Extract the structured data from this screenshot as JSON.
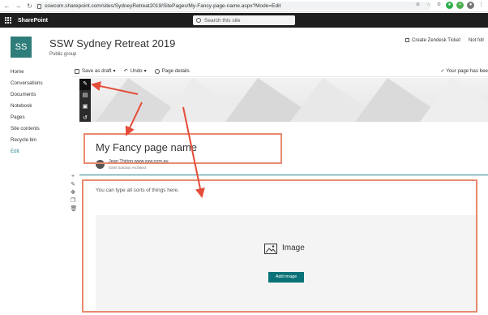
{
  "browser": {
    "url": "sswcom.sharepoint.com/sites/SydneyRetreat2019/SitePages/My-Fancy-page-name.aspx?Mode=Edit",
    "nav_back": "←",
    "nav_forward": "→",
    "nav_reload": "↻"
  },
  "suite": {
    "title": "SharePoint",
    "search_placeholder": "Search this site"
  },
  "site": {
    "logo": "SS",
    "title": "SSW Sydney Retreat 2019",
    "subtitle": "Public group",
    "action_ticket": "Create Zendesk Ticket",
    "action_follow": "Not foll"
  },
  "nav": {
    "items": [
      {
        "label": "Home"
      },
      {
        "label": "Conversations"
      },
      {
        "label": "Documents"
      },
      {
        "label": "Notebook"
      },
      {
        "label": "Pages"
      },
      {
        "label": "Site contents"
      },
      {
        "label": "Recycle bin"
      }
    ],
    "edit": "Edit"
  },
  "cmdbar": {
    "save_draft": "Save as draft",
    "undo": "Undo",
    "page_details": "Page details",
    "saved_status": "Your page has bee"
  },
  "page": {
    "title": "My Fancy page name",
    "author_name": "Jean Thirion www.ssw.com.au",
    "author_role": "SSW Solution Architect",
    "text_hint": "You can type all sorts of things here.",
    "image_label": "Image",
    "add_image": "Add image"
  },
  "colors": {
    "suite_bg": "#1e1e1e",
    "accent": "#2a8590",
    "logo": "#2f7d7a",
    "annotation": "#e98a6e",
    "arrow": "#e44d3a"
  }
}
